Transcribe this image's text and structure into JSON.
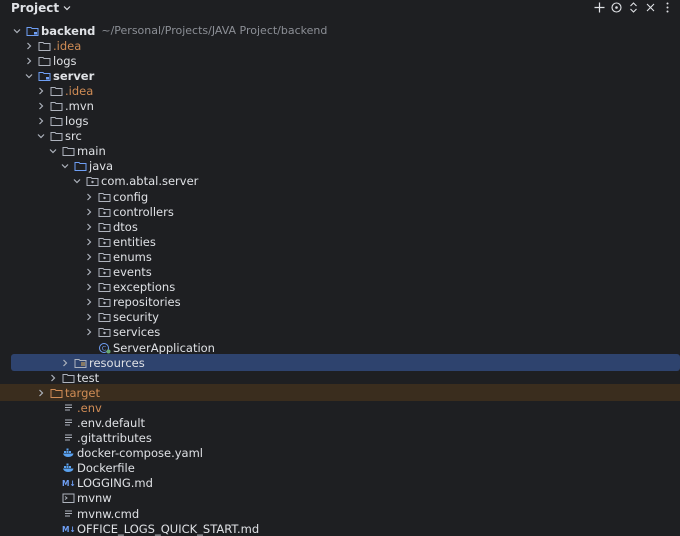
{
  "panel": {
    "title": "Project",
    "actions": [
      "add-icon",
      "locate-icon",
      "expand-collapse-icon",
      "close-icon",
      "more-icon"
    ]
  },
  "tree": [
    {
      "label": "backend",
      "hint": "~/Personal/Projects/JAVA Project/backend",
      "depth": 0,
      "state": "open",
      "icon": "module-folder-icon",
      "style": "bold"
    },
    {
      "label": ".idea",
      "depth": 1,
      "state": "closed",
      "icon": "folder-icon",
      "style": "orange"
    },
    {
      "label": "logs",
      "depth": 1,
      "state": "closed",
      "icon": "folder-icon",
      "style": ""
    },
    {
      "label": "server",
      "depth": 1,
      "state": "open",
      "icon": "module-folder-icon",
      "style": "bold"
    },
    {
      "label": ".idea",
      "depth": 2,
      "state": "closed",
      "icon": "folder-icon",
      "style": "orange"
    },
    {
      "label": ".mvn",
      "depth": 2,
      "state": "closed",
      "icon": "folder-icon",
      "style": ""
    },
    {
      "label": "logs",
      "depth": 2,
      "state": "closed",
      "icon": "folder-icon",
      "style": ""
    },
    {
      "label": "src",
      "depth": 2,
      "state": "open",
      "icon": "folder-icon",
      "style": ""
    },
    {
      "label": "main",
      "depth": 3,
      "state": "open",
      "icon": "folder-icon",
      "style": ""
    },
    {
      "label": "java",
      "depth": 4,
      "state": "open",
      "icon": "source-folder-icon",
      "style": ""
    },
    {
      "label": "com.abtal.server",
      "depth": 5,
      "state": "open",
      "icon": "package-icon",
      "style": ""
    },
    {
      "label": "config",
      "depth": 6,
      "state": "closed",
      "icon": "package-icon",
      "style": ""
    },
    {
      "label": "controllers",
      "depth": 6,
      "state": "closed",
      "icon": "package-icon",
      "style": ""
    },
    {
      "label": "dtos",
      "depth": 6,
      "state": "closed",
      "icon": "package-icon",
      "style": ""
    },
    {
      "label": "entities",
      "depth": 6,
      "state": "closed",
      "icon": "package-icon",
      "style": ""
    },
    {
      "label": "enums",
      "depth": 6,
      "state": "closed",
      "icon": "package-icon",
      "style": ""
    },
    {
      "label": "events",
      "depth": 6,
      "state": "closed",
      "icon": "package-icon",
      "style": ""
    },
    {
      "label": "exceptions",
      "depth": 6,
      "state": "closed",
      "icon": "package-icon",
      "style": ""
    },
    {
      "label": "repositories",
      "depth": 6,
      "state": "closed",
      "icon": "package-icon",
      "style": ""
    },
    {
      "label": "security",
      "depth": 6,
      "state": "closed",
      "icon": "package-icon",
      "style": ""
    },
    {
      "label": "services",
      "depth": 6,
      "state": "closed",
      "icon": "package-icon",
      "style": ""
    },
    {
      "label": "ServerApplication",
      "depth": 6,
      "state": "none",
      "icon": "spring-class-icon",
      "style": ""
    },
    {
      "label": "resources",
      "depth": 4,
      "state": "closed",
      "icon": "resources-folder-icon",
      "style": "",
      "selected": true
    },
    {
      "label": "test",
      "depth": 3,
      "state": "closed",
      "icon": "folder-icon",
      "style": ""
    },
    {
      "label": "target",
      "depth": 2,
      "state": "closed",
      "icon": "excluded-folder-icon",
      "style": "orange",
      "excluded": true
    },
    {
      "label": ".env",
      "depth": 3,
      "state": "none",
      "icon": "text-file-icon",
      "style": "orange"
    },
    {
      "label": ".env.default",
      "depth": 3,
      "state": "none",
      "icon": "text-file-icon",
      "style": ""
    },
    {
      "label": ".gitattributes",
      "depth": 3,
      "state": "none",
      "icon": "text-file-icon",
      "style": ""
    },
    {
      "label": "docker-compose.yaml",
      "depth": 3,
      "state": "none",
      "icon": "docker-icon",
      "style": ""
    },
    {
      "label": "Dockerfile",
      "depth": 3,
      "state": "none",
      "icon": "docker-icon",
      "style": ""
    },
    {
      "label": "LOGGING.md",
      "depth": 3,
      "state": "none",
      "icon": "markdown-icon",
      "style": ""
    },
    {
      "label": "mvnw",
      "depth": 3,
      "state": "none",
      "icon": "shell-script-icon",
      "style": ""
    },
    {
      "label": "mvnw.cmd",
      "depth": 3,
      "state": "none",
      "icon": "text-file-icon",
      "style": ""
    },
    {
      "label": "OFFICE_LOGS_QUICK_START.md",
      "depth": 3,
      "state": "none",
      "icon": "markdown-icon",
      "style": ""
    }
  ],
  "colors": {
    "background": "#1e1f22",
    "text": "#dfe1e5",
    "excluded_text": "#d08c55",
    "selection": "#2e436e",
    "hint": "#8c8f96"
  }
}
